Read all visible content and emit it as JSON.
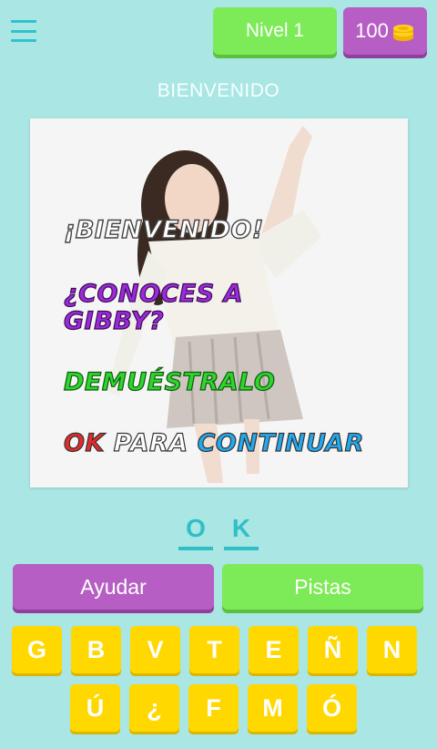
{
  "header": {
    "level_label": "Nivel 1",
    "coins": "100",
    "menu_icon": "hamburger-menu-icon",
    "coin_icon": "coin-stack-icon"
  },
  "title": "BIENVENIDO",
  "image_overlay": {
    "line1": "¡BIENVENIDO!",
    "line2": "¿CONOCES A GIBBY?",
    "line3": "DEMUÉSTRALO",
    "line4_word1": "OK",
    "line4_word2": "PARA",
    "line4_word3": "CONTINUAR"
  },
  "answer": [
    "O",
    "K"
  ],
  "buttons": {
    "help": "Ayudar",
    "hints": "Pistas"
  },
  "keyboard": {
    "row1": [
      "G",
      "B",
      "V",
      "T",
      "E",
      "Ñ",
      "N"
    ],
    "row2": [
      "Ú",
      "¿",
      "F",
      "M",
      "Ó"
    ]
  },
  "colors": {
    "background": "#a9e6e4",
    "green": "#7dea57",
    "purple": "#b75ec4",
    "yellow": "#ffd800",
    "teal": "#2fbfc7"
  }
}
